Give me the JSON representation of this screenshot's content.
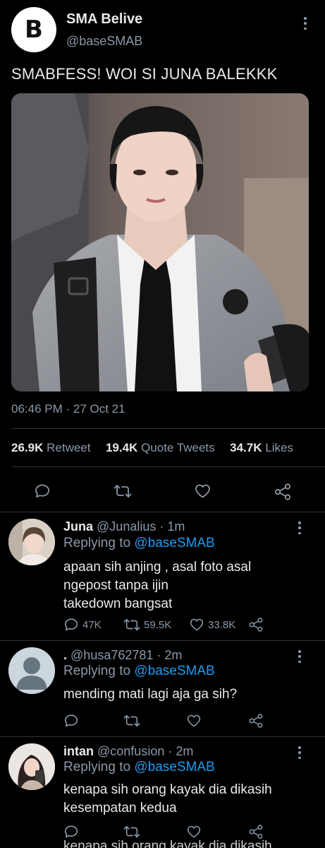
{
  "tweet": {
    "author_name": "SMA Belive",
    "author_handle": "@baseSMAB",
    "avatar_letter": "B",
    "text": "SMABFESS! WOI SI JUNA BALEKKK",
    "timestamp": "06:46 PM · 27 Oct 21",
    "stats": {
      "retweets": "26.9K",
      "retweets_label": "Retweet",
      "quotes": "19.4K",
      "quotes_label": "Quote Tweets",
      "likes": "34.7K",
      "likes_label": "Likes"
    },
    "icons": [
      "reply-icon",
      "retweet-icon",
      "like-icon",
      "share-icon"
    ]
  },
  "replies": [
    {
      "name": "Juna",
      "handle": "@Junalius",
      "time": "· 1m",
      "replying_prefix": "Replying to",
      "replying_handle": "@baseSMAB",
      "lines": [
        "apaan sih anjing , asal foto asal",
        "ngepost tanpa ijin",
        "takedown bangsat"
      ],
      "reply_count": "47K",
      "retweet_count": "59.5K",
      "like_count": "33.8K"
    },
    {
      "name": ".",
      "handle": "@husa762781",
      "time": "· 2m",
      "replying_prefix": "Replying to",
      "replying_handle": "@baseSMAB",
      "lines": [
        "mending mati lagi aja ga sih?"
      ]
    },
    {
      "name": "intan",
      "handle": "@confusion",
      "time": "· 2m",
      "replying_prefix": "Replying to",
      "replying_handle": "@baseSMAB",
      "lines": [
        "kenapa sih orang kayak dia dikasih",
        "kesempatan kedua"
      ],
      "overlap_text": "kenapa sih orang kayak dia dikasih"
    }
  ],
  "colors": {
    "background": "#000000",
    "accent": "#1d9bf0",
    "muted": "#8b98a5",
    "divider": "#2f3336"
  }
}
